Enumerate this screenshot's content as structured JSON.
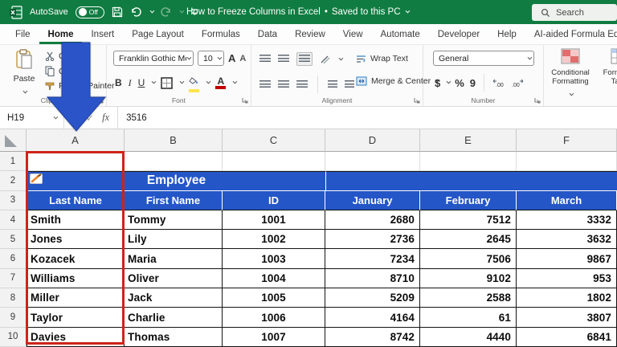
{
  "colors": {
    "titlebar_green": "#107C41",
    "table_blue": "#2456C8",
    "arrow_blue": "#2B54C9",
    "annotation_red": "#CE2418"
  },
  "titlebar": {
    "autosave_label": "AutoSave",
    "autosave_state": "Off",
    "doc_title": "How to Freeze Columns in Excel",
    "separator": "•",
    "doc_status": "Saved to this PC",
    "search_label": "Search"
  },
  "menubar": {
    "active_tab": "Home",
    "tabs": [
      "File",
      "Home",
      "Insert",
      "Page Layout",
      "Formulas",
      "Data",
      "Review",
      "View",
      "Automate",
      "Developer",
      "Help",
      "AI-aided Formula Editor"
    ]
  },
  "ribbon": {
    "clipboard": {
      "group_label": "Clipboard",
      "paste_label": "Paste",
      "cut_label": "Cut",
      "copy_label": "Copy",
      "format_painter_label": "Format Painter"
    },
    "font": {
      "group_label": "Font",
      "font_name": "Franklin Gothic Me",
      "font_size": "10",
      "bold": "B",
      "italic": "I",
      "underline": "U",
      "grow_font": "A",
      "shrink_font": "A",
      "font_color_letter": "A"
    },
    "alignment": {
      "group_label": "Alignment",
      "wrap_text_label": "Wrap Text",
      "merge_center_label": "Merge & Center"
    },
    "number": {
      "group_label": "Number",
      "format_value": "General",
      "currency": "$",
      "percent": "%",
      "comma": "9"
    },
    "styles": {
      "conditional_formatting_label": "Conditional Formatting",
      "format_as_table_label": "Format as Table"
    }
  },
  "formula_bar": {
    "name_box": "H19",
    "fx_label": "fx",
    "value": "3516"
  },
  "sheet": {
    "column_headers": [
      "A",
      "B",
      "C",
      "D",
      "E",
      "F"
    ],
    "row_headers": [
      "1",
      "2",
      "3",
      "4",
      "5",
      "6",
      "7",
      "8",
      "9",
      "10"
    ],
    "table": {
      "banner": "Employee",
      "headers": [
        "Last Name",
        "First Name",
        "ID",
        "January",
        "February",
        "March"
      ],
      "rows": [
        [
          "Smith",
          "Tommy",
          "1001",
          "2680",
          "7512",
          "3332"
        ],
        [
          "Jones",
          "Lily",
          "1002",
          "2736",
          "2645",
          "3632"
        ],
        [
          "Kozacek",
          "Maria",
          "1003",
          "7234",
          "7506",
          "9867"
        ],
        [
          "Williams",
          "Oliver",
          "1004",
          "8710",
          "9102",
          "953"
        ],
        [
          "Miller",
          "Jack",
          "1005",
          "5209",
          "2588",
          "1802"
        ],
        [
          "Taylor",
          "Charlie",
          "1006",
          "4164",
          "61",
          "3807"
        ],
        [
          "Davies",
          "Thomas",
          "1007",
          "8742",
          "4440",
          "6841"
        ]
      ]
    }
  }
}
